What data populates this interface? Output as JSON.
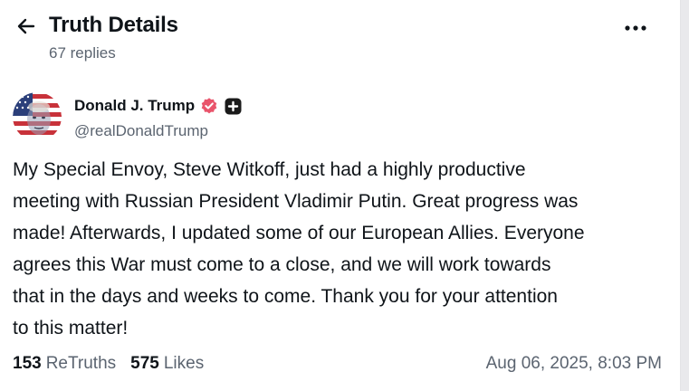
{
  "header": {
    "title": "Truth Details",
    "replies": "67 replies"
  },
  "author": {
    "name": "Donald J. Trump",
    "handle": "@realDonaldTrump"
  },
  "post": {
    "lines": [
      "My Special Envoy, Steve Witkoff, just had a highly productive",
      "meeting with Russian President Vladimir Putin. Great progress was",
      "made! Afterwards, I updated some of our European Allies. Everyone",
      "agrees this War must come to a close, and we will work towards",
      "that in the days and weeks to come. Thank you for your attention",
      "to this matter!"
    ]
  },
  "stats": {
    "retruths_count": "153",
    "retruths_label": "ReTruths",
    "likes_count": "575",
    "likes_label": "Likes"
  },
  "timestamp": "Aug 06, 2025, 8:03 PM",
  "colors": {
    "text": "#0f1419",
    "muted": "#5b6470",
    "verified_badge": "#e9546b",
    "plus_badge": "#1a1a1a"
  },
  "icons": {
    "back": "arrow-left-icon",
    "more": "more-horizontal-icon",
    "verified": "verified-badge-icon",
    "plus": "plus-badge-icon"
  }
}
